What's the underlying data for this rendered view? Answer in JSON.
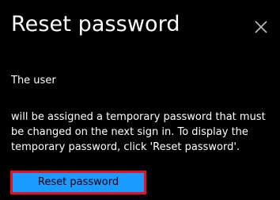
{
  "dialog": {
    "title": "Reset password",
    "close_icon": "close-icon",
    "message_user": "The user",
    "message_body": "will be assigned a temporary password that must be changed on the next sign in. To display the temporary password, click 'Reset password'.",
    "reset_button_label": "Reset password"
  },
  "colors": {
    "background": "#000000",
    "text": "#ffffff",
    "button_fill": "#1a9bff",
    "button_text": "#000000",
    "highlight_outline": "#e81123"
  }
}
